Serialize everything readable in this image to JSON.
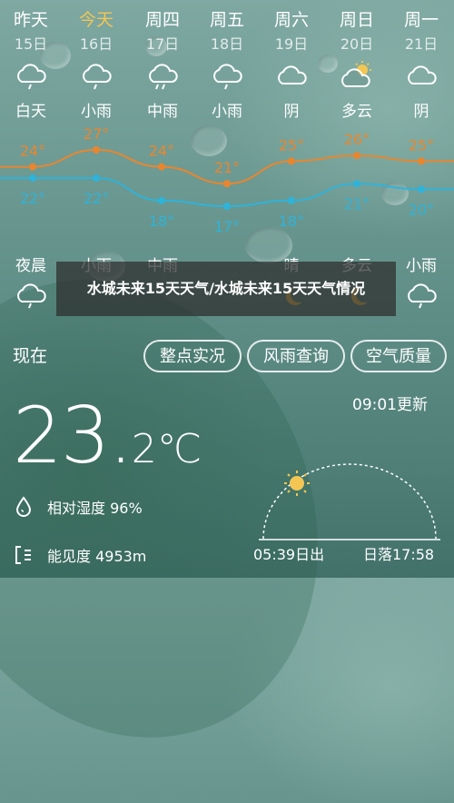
{
  "forecast": {
    "days": [
      {
        "name": "昨天",
        "date": "15日",
        "weather": "白天",
        "icon": "cloud-rain-icon",
        "high": 24,
        "low": 22,
        "night_label": "夜晨",
        "night_icon": "cloud-rain-icon"
      },
      {
        "name": "今天",
        "date": "16日",
        "weather": "小雨",
        "icon": "cloud-rain-icon",
        "high": 27,
        "low": 22,
        "night_label": "小雨",
        "night_icon": "cloud-rain-icon",
        "today": true
      },
      {
        "name": "周四",
        "date": "17日",
        "weather": "中雨",
        "icon": "cloud-heavy-rain-icon",
        "high": 24,
        "low": 18,
        "night_label": "中雨",
        "night_icon": "cloud-rain-icon"
      },
      {
        "name": "周五",
        "date": "18日",
        "weather": "小雨",
        "icon": "cloud-rain-icon",
        "high": 21,
        "low": 17,
        "night_label": "",
        "night_icon": "cloud-icon"
      },
      {
        "name": "周六",
        "date": "19日",
        "weather": "阴",
        "icon": "cloud-icon",
        "high": 25,
        "low": 18,
        "night_label": "晴",
        "night_icon": "moon-icon"
      },
      {
        "name": "周日",
        "date": "20日",
        "weather": "多云",
        "icon": "sun-cloud-icon",
        "high": 26,
        "low": 21,
        "night_label": "多云",
        "night_icon": "moon-icon"
      },
      {
        "name": "周一",
        "date": "21日",
        "weather": "阴",
        "icon": "cloud-icon",
        "high": 25,
        "low": 20,
        "night_label": "小雨",
        "night_icon": "cloud-rain-icon"
      }
    ],
    "high_labels": [
      "24°",
      "27°",
      "24°",
      "21°",
      "25°",
      "26°",
      "25°"
    ],
    "low_labels": [
      "22°",
      "22°",
      "18°",
      "17°",
      "18°",
      "21°",
      "20°"
    ]
  },
  "colors": {
    "high_line": "#e8862f",
    "low_line": "#2fb3d9",
    "today": "#f3c653"
  },
  "overlay": {
    "title": "水城未来15天天气/水城未来15天天气情况"
  },
  "current": {
    "label": "现在",
    "buttons": [
      "整点实况",
      "风雨查询",
      "空气质量"
    ],
    "updated": "09:01更新",
    "temp_main": "23.",
    "temp_unit": "2℃",
    "humidity": "相对湿度 96%",
    "visibility": "能见度 4953m",
    "sunrise": "05:39日出",
    "sunset": "日落17:58"
  }
}
